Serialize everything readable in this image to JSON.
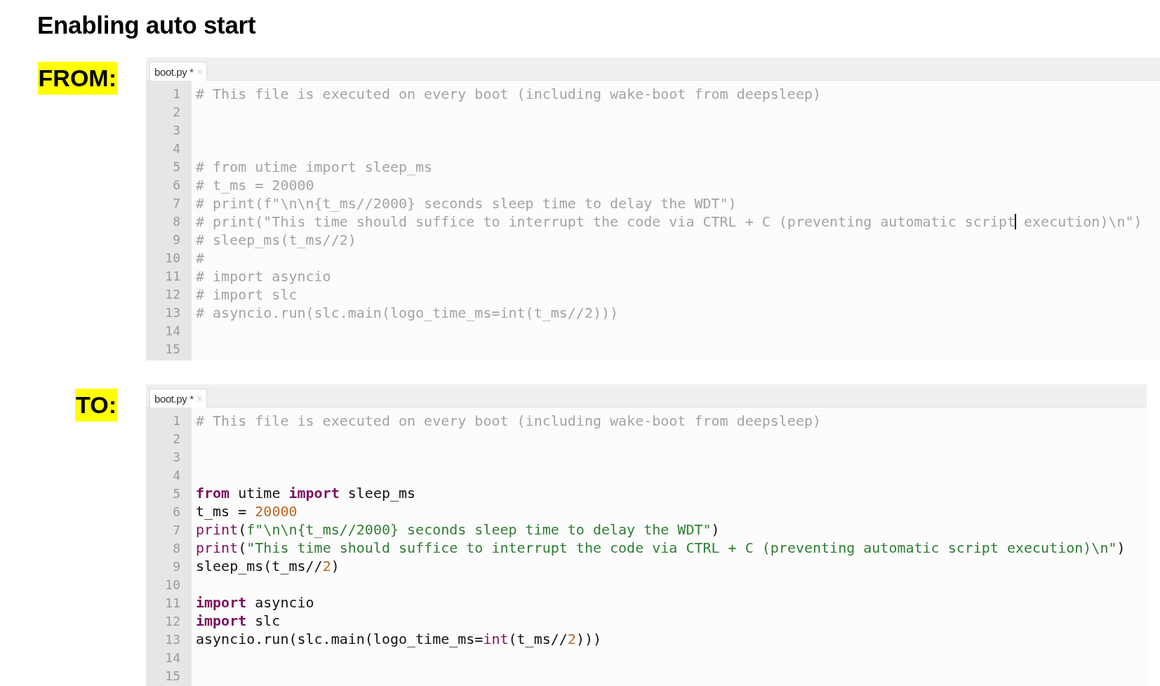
{
  "title": "Enabling auto start",
  "sections": [
    {
      "label": "FROM:",
      "editor": {
        "tabs": [
          {
            "label": "boot.py *",
            "selected": true
          }
        ],
        "lines": [
          {
            "number": "1",
            "tokens": [
              {
                "kind": "comment",
                "text": "# This file is executed on every boot (including wake-boot from deepsleep)"
              }
            ]
          },
          {
            "number": "2"
          },
          {
            "number": "3"
          },
          {
            "number": "4"
          },
          {
            "number": "5",
            "tokens": [
              {
                "kind": "comment",
                "text": "# from utime import sleep_ms"
              }
            ]
          },
          {
            "number": "6",
            "tokens": [
              {
                "kind": "comment",
                "text": "# t_ms = 20000"
              }
            ]
          },
          {
            "number": "7",
            "tokens": [
              {
                "kind": "comment",
                "text": "# print(f\"\\n\\n{t_ms//2000} seconds sleep time to delay the WDT\")"
              }
            ]
          },
          {
            "number": "8",
            "tokens": [
              {
                "kind": "comment",
                "text": "# print(\"This time should suffice to interrupt the code via CTRL + C (preventing automatic script"
              },
              {
                "kind": "caret"
              },
              {
                "kind": "comment",
                "text": " execution)\\n\")"
              }
            ]
          },
          {
            "number": "9",
            "tokens": [
              {
                "kind": "comment",
                "text": "# sleep_ms(t_ms//2)"
              }
            ]
          },
          {
            "number": "10",
            "tokens": [
              {
                "kind": "comment",
                "text": "#"
              }
            ]
          },
          {
            "number": "11",
            "tokens": [
              {
                "kind": "comment",
                "text": "# import asyncio"
              }
            ]
          },
          {
            "number": "12",
            "tokens": [
              {
                "kind": "comment",
                "text": "# import slc"
              }
            ]
          },
          {
            "number": "13",
            "tokens": [
              {
                "kind": "comment",
                "text": "# asyncio.run(slc.main(logo_time_ms=int(t_ms//2)))"
              }
            ]
          },
          {
            "number": "14"
          },
          {
            "number": "15"
          }
        ]
      }
    },
    {
      "label": "TO:",
      "editor": {
        "tabs": [
          {
            "label": "boot.py *",
            "selected": true
          }
        ],
        "lines": [
          {
            "number": "1",
            "tokens": [
              {
                "kind": "comment",
                "text": "# This file is executed on every boot (including wake-boot from deepsleep)"
              }
            ]
          },
          {
            "number": "2"
          },
          {
            "number": "3"
          },
          {
            "number": "4"
          },
          {
            "number": "5",
            "tokens": [
              {
                "kind": "keyword",
                "text": "from"
              },
              {
                "kind": "plain",
                "text": " utime "
              },
              {
                "kind": "keyword",
                "text": "import"
              },
              {
                "kind": "plain",
                "text": " sleep_ms"
              }
            ]
          },
          {
            "number": "6",
            "tokens": [
              {
                "kind": "plain",
                "text": "t_ms = "
              },
              {
                "kind": "number",
                "text": "20000"
              }
            ]
          },
          {
            "number": "7",
            "tokens": [
              {
                "kind": "builtin",
                "text": "print"
              },
              {
                "kind": "plain",
                "text": "("
              },
              {
                "kind": "string",
                "text": "f\"\\n\\n{t_ms//2000} seconds sleep time to delay the WDT\""
              },
              {
                "kind": "plain",
                "text": ")"
              }
            ]
          },
          {
            "number": "8",
            "tokens": [
              {
                "kind": "builtin",
                "text": "print"
              },
              {
                "kind": "plain",
                "text": "("
              },
              {
                "kind": "string",
                "text": "\"This time should suffice to interrupt the code via CTRL + C (preventing automatic script execution)\\n\""
              },
              {
                "kind": "plain",
                "text": ")"
              }
            ]
          },
          {
            "number": "9",
            "tokens": [
              {
                "kind": "plain",
                "text": "sleep_ms(t_ms//"
              },
              {
                "kind": "number",
                "text": "2"
              },
              {
                "kind": "plain",
                "text": ")"
              }
            ]
          },
          {
            "number": "10"
          },
          {
            "number": "11",
            "tokens": [
              {
                "kind": "keyword",
                "text": "import"
              },
              {
                "kind": "plain",
                "text": " asyncio"
              }
            ]
          },
          {
            "number": "12",
            "tokens": [
              {
                "kind": "keyword",
                "text": "import"
              },
              {
                "kind": "plain",
                "text": " slc"
              }
            ]
          },
          {
            "number": "13",
            "tokens": [
              {
                "kind": "plain",
                "text": "asyncio.run(slc.main(logo_time_ms="
              },
              {
                "kind": "builtin",
                "text": "int"
              },
              {
                "kind": "plain",
                "text": "(t_ms//"
              },
              {
                "kind": "number",
                "text": "2"
              },
              {
                "kind": "plain",
                "text": ")))"
              }
            ]
          },
          {
            "number": "14"
          },
          {
            "number": "15"
          }
        ]
      }
    }
  ]
}
